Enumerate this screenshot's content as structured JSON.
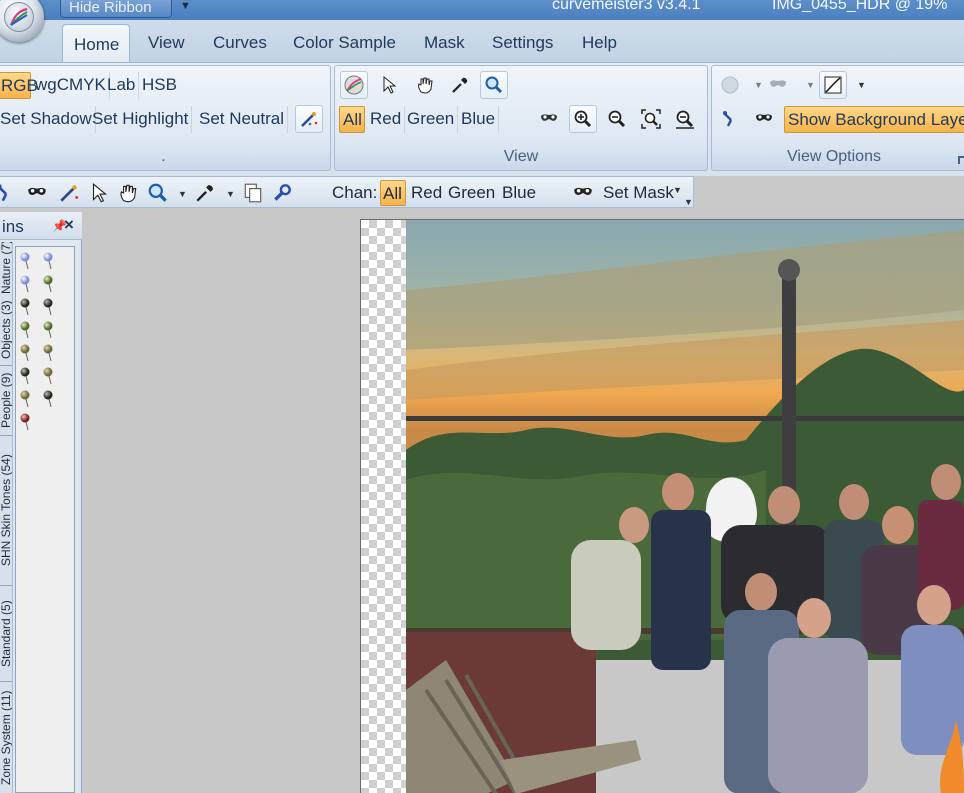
{
  "titlebar": {
    "hide_ribbon": "Hide Ribbon",
    "app_title": "curvemeister3 v3.4.1",
    "doc_title": "IMG_0455_HDR @ 19%"
  },
  "tabs": [
    {
      "label": "Home"
    },
    {
      "label": "View"
    },
    {
      "label": "Curves"
    },
    {
      "label": "Color Sample"
    },
    {
      "label": "Mask"
    },
    {
      "label": "Settings"
    },
    {
      "label": "Help"
    }
  ],
  "ribbon": {
    "home": {
      "color_spaces": [
        "RGB",
        "wgCMYK",
        "Lab",
        "HSB"
      ],
      "set_shadow": "Set Shadow",
      "set_highlight": "Set Highlight",
      "set_neutral": "Set Neutral",
      "group_label": "."
    },
    "view": {
      "channels": [
        "All",
        "Red",
        "Green",
        "Blue"
      ],
      "group_label": "View"
    },
    "view_options": {
      "show_background": "Show Background Layer",
      "group_label": "View Options"
    }
  },
  "toolbar": {
    "chan_label": "Chan:",
    "channels": [
      "All",
      "Red",
      "Green",
      "Blue"
    ],
    "set_mask": "Set Mask"
  },
  "panel": {
    "title": "ins",
    "vtabs": [
      "Zone System (11)",
      "Standard (5)",
      "SHN Skin Tones (54)",
      "People (9)",
      "Objects (3)",
      "Nature (7)"
    ]
  },
  "colors": {
    "accent_selected": "#f7b24a",
    "ribbon_blue": "#dde7f3",
    "title_blue": "#4a7fbf"
  }
}
